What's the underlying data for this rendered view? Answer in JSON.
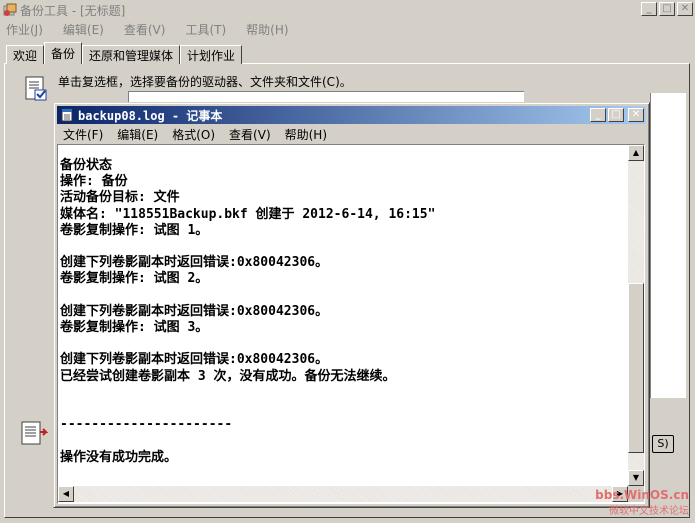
{
  "background_window": {
    "title": "备份工具 - [无标题]",
    "menu": [
      "作业(J)",
      "编辑(E)",
      "查看(V)",
      "工具(T)",
      "帮助(H)"
    ],
    "tabs": [
      "欢迎",
      "备份",
      "还原和管理媒体",
      "计划作业"
    ],
    "active_tab": "备份",
    "instruction": "单击复选框，选择要备份的驱动器、文件夹和文件(C)。",
    "side_button_label": "S)"
  },
  "notepad": {
    "title": "backup08.log - 记事本",
    "menu": [
      "文件(F)",
      "编辑(E)",
      "格式(O)",
      "查看(V)",
      "帮助(H)"
    ],
    "content": "备份状态\n操作: 备份\n活动备份目标: 文件\n媒体名: \"118551Backup.bkf 创建于 2012-6-14, 16:15\"\n卷影复制操作: 试图 1。\n\n创建下列卷影副本时返回错误:0x80042306。\n卷影复制操作: 试图 2。\n\n创建下列卷影副本时返回错误:0x80042306。\n卷影复制操作: 试图 3。\n\n创建下列卷影副本时返回错误:0x80042306。\n已经尝试创建卷影副本 3 次，没有成功。备份无法继续。\n\n\n----------------------\n\n操作没有成功完成。"
  },
  "caption_buttons": {
    "minimize": "_",
    "maximize": "□",
    "close": "✕"
  },
  "watermark": {
    "line1": "bbs.WinOS.cn",
    "line2": "微软中文技术论坛"
  },
  "colors": {
    "titlebar_start": "#0a246a",
    "titlebar_end": "#a6caf0",
    "face": "#d4d0c8"
  }
}
